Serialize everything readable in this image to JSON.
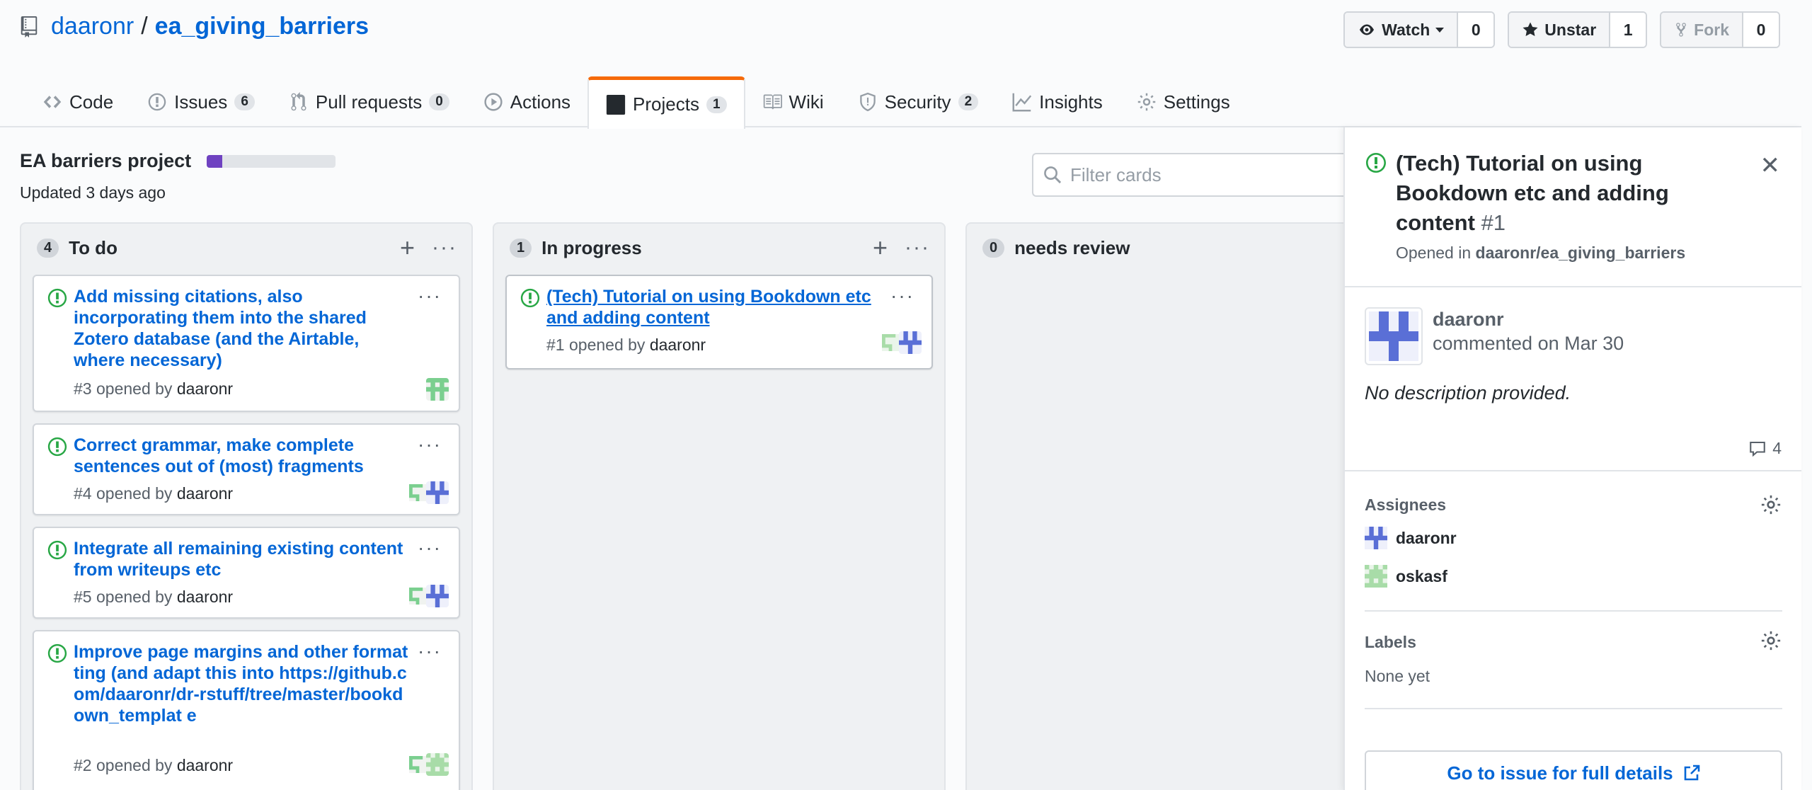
{
  "repo": {
    "owner": "daaronr",
    "separator": "/",
    "name": "ea_giving_barriers"
  },
  "header_actions": {
    "watch": {
      "label": "Watch",
      "count": "0"
    },
    "unstar": {
      "label": "Unstar",
      "count": "1"
    },
    "fork": {
      "label": "Fork",
      "count": "0"
    }
  },
  "tabs": [
    {
      "label": "Code",
      "icon": "code-icon"
    },
    {
      "label": "Issues",
      "badge": "6",
      "icon": "issue-icon"
    },
    {
      "label": "Pull requests",
      "badge": "0",
      "icon": "pull-request-icon"
    },
    {
      "label": "Actions",
      "icon": "play-icon"
    },
    {
      "label": "Projects",
      "badge": "1",
      "icon": "project-icon",
      "active": true
    },
    {
      "label": "Wiki",
      "icon": "book-icon"
    },
    {
      "label": "Security",
      "badge": "2",
      "icon": "shield-icon"
    },
    {
      "label": "Insights",
      "icon": "graph-icon"
    },
    {
      "label": "Settings",
      "icon": "gear-icon"
    }
  ],
  "project": {
    "name": "EA barriers project",
    "updated": "Updated 3 days ago",
    "progress": 0.12
  },
  "filter": {
    "placeholder": "Filter cards"
  },
  "columns": [
    {
      "count": "4",
      "title": "To do",
      "cards": [
        {
          "title": "Add missing citations, also incorporating them into the shared Zotero database (and the Airtable, where necessary)",
          "number": "#3",
          "opened_by": "opened by",
          "user": "daaronr"
        },
        {
          "title": "Correct grammar, make complete sentences out of (most) fragments",
          "number": "#4",
          "opened_by": "opened by",
          "user": "daaronr"
        },
        {
          "title": "Integrate all remaining existing content from writeups etc",
          "number": "#5",
          "opened_by": "opened by",
          "user": "daaronr"
        },
        {
          "title": "Improve page margins and other formatting (and adapt this into https://github.com/daaronr/dr-rstuff/tree/master/bookdown_templat e",
          "number": "#2",
          "opened_by": "opened by",
          "user": "daaronr"
        }
      ]
    },
    {
      "count": "1",
      "title": "In progress",
      "cards": [
        {
          "title": "(Tech) Tutorial on using Bookdown etc and adding content",
          "number": "#1",
          "opened_by": "opened by",
          "user": "daaronr"
        }
      ]
    },
    {
      "count": "0",
      "title": "needs review",
      "cards": []
    }
  ],
  "panel": {
    "title": "(Tech) Tutorial on using Bookdown etc and adding content",
    "number": "#1",
    "opened_in_prefix": "Opened in",
    "opened_in_repo": "daaronr/ea_giving_barriers",
    "comment_user": "daaronr",
    "comment_date": "commented on Mar 30",
    "description": "No description provided.",
    "comment_count": "4",
    "assignees_label": "Assignees",
    "assignees": [
      "daaronr",
      "oskasf"
    ],
    "labels_label": "Labels",
    "labels_value": "None yet",
    "goto_label": "Go to issue for full details"
  },
  "colors": {
    "link": "#0366d6",
    "open_issue": "#28a745",
    "accent_tab": "#f66a0a",
    "progress": "#6f42c1"
  }
}
